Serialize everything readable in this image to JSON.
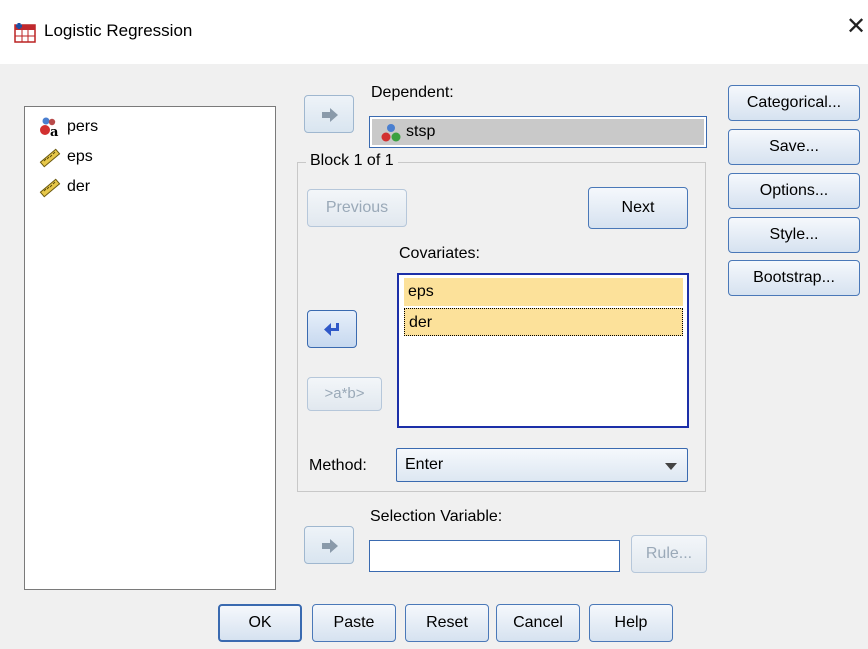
{
  "window": {
    "title": "Logistic Regression",
    "close_glyph": "✕"
  },
  "source_variables": [
    {
      "label": "pers",
      "icon": "nominal-string-icon"
    },
    {
      "label": "eps",
      "icon": "scale-ruler-icon"
    },
    {
      "label": "der",
      "icon": "scale-ruler-icon"
    }
  ],
  "dependent": {
    "label": "Dependent:",
    "value": "stsp",
    "icon": "nominal-icon"
  },
  "block": {
    "title": "Block 1 of 1",
    "previous_label": "Previous",
    "next_label": "Next",
    "interaction_label": ">a*b>"
  },
  "covariates": {
    "label": "Covariates:",
    "items": [
      "eps",
      "der"
    ]
  },
  "method": {
    "label": "Method:",
    "value": "Enter"
  },
  "selection_variable": {
    "label": "Selection Variable:",
    "value": "",
    "rule_label": "Rule..."
  },
  "side_buttons": [
    "Categorical...",
    "Save...",
    "Options...",
    "Style...",
    "Bootstrap..."
  ],
  "bottom_buttons": [
    "OK",
    "Paste",
    "Reset",
    "Cancel",
    "Help"
  ],
  "colors": {
    "selected_item": "#fce19a",
    "list_border": "#1c2fa8",
    "accent": "#3a6ab0"
  }
}
